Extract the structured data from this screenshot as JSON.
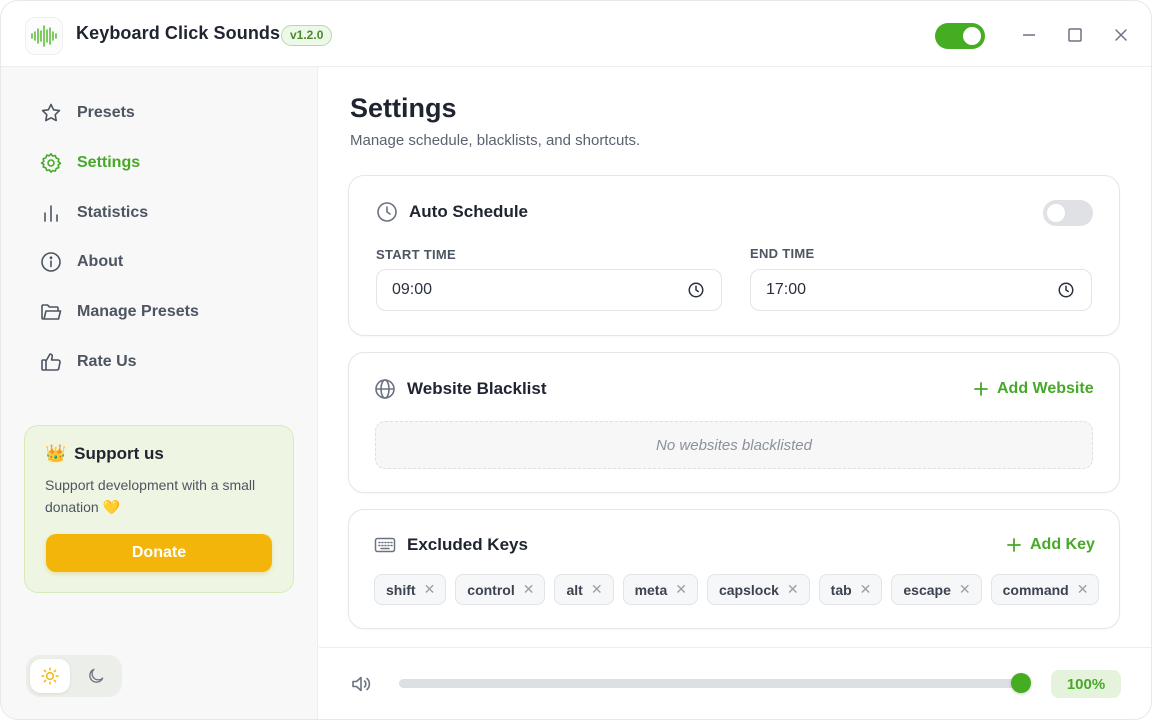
{
  "app": {
    "title": "Keyboard Click Sounds",
    "version": "v1.2.0",
    "enabled": true,
    "accent_color": "#44ad21"
  },
  "window_controls": [
    "minimize-icon",
    "maximize-icon",
    "close-icon"
  ],
  "sidebar": {
    "items": [
      {
        "label": "Presets",
        "icon": "star-icon",
        "active": false
      },
      {
        "label": "Settings",
        "icon": "gear-icon",
        "active": true
      },
      {
        "label": "Statistics",
        "icon": "bar-chart-icon",
        "active": false
      },
      {
        "label": "About",
        "icon": "info-icon",
        "active": false
      },
      {
        "label": "Manage Presets",
        "icon": "folder-icon",
        "active": false
      },
      {
        "label": "Rate Us",
        "icon": "thumbs-up-icon",
        "active": false
      }
    ],
    "support": {
      "emoji": "👑",
      "title": "Support us",
      "text": "Support development with a small donation 💛",
      "button": "Donate",
      "button_color": "#f4b50a"
    },
    "theme": {
      "selected": "light"
    }
  },
  "main": {
    "title": "Settings",
    "subtitle": "Manage schedule, blacklists, and shortcuts.",
    "auto_schedule": {
      "title": "Auto Schedule",
      "enabled": false,
      "start_label": "START TIME",
      "start_value": "09:00",
      "end_label": "END TIME",
      "end_value": "17:00"
    },
    "website_blacklist": {
      "title": "Website Blacklist",
      "add_label": "Add Website",
      "empty_text": "No websites blacklisted"
    },
    "excluded_keys": {
      "title": "Excluded Keys",
      "add_label": "Add Key",
      "keys": [
        "shift",
        "control",
        "alt",
        "meta",
        "capslock",
        "tab",
        "escape",
        "command"
      ]
    }
  },
  "volume": {
    "percent_label": "100%",
    "value": 1.0
  }
}
